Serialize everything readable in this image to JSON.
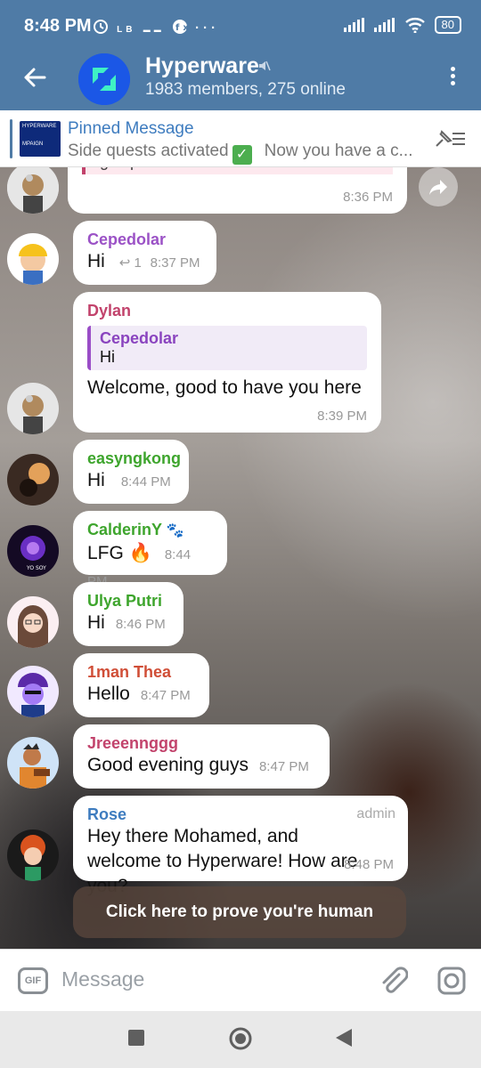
{
  "status": {
    "time": "8:48 PM",
    "icons": [
      "alarm-icon",
      "lb-icon",
      "app-icon",
      "fx-icon",
      "more-icon"
    ],
    "battery": "80"
  },
  "header": {
    "title": "Hyperware",
    "subtitle": "1983 members, 275 online"
  },
  "pinned": {
    "title": "Pinned Message",
    "text_start": "Side quests activated",
    "text_end": "Now you have a c...",
    "thumb_text": "HYPERWARE",
    "thumb_text2": "MPAIGN"
  },
  "messages": [
    {
      "name": "",
      "text": "lightspeed.",
      "time": "8:36 PM"
    },
    {
      "name": "Cepedolar",
      "text": "Hi",
      "reply_count": "1",
      "time": "8:37 PM",
      "color": "#9b52c6"
    },
    {
      "name": "Dylan",
      "reply_name": "Cepedolar",
      "reply_text": "Hi",
      "text": "Welcome, good to have you here",
      "time": "8:39 PM",
      "color": "#c2436c"
    },
    {
      "name": "easyngkong",
      "text": "Hi",
      "time": "8:44 PM",
      "color": "#3ea52d"
    },
    {
      "name": "CalderinY",
      "name_suffix": "🐾",
      "text": "LFG",
      "emoji": "🔥",
      "time": "8:44 PM",
      "color": "#3ea52d"
    },
    {
      "name": "Ulya Putri",
      "text": "Hi",
      "time": "8:46 PM",
      "color": "#3ea52d"
    },
    {
      "name": "1man Thea",
      "text": "Hello",
      "time": "8:47 PM",
      "color": "#d04e37"
    },
    {
      "name": "Jreeennggg",
      "text": "Good evening guys",
      "time": "8:47 PM",
      "color": "#c2436c"
    },
    {
      "name": "Rose",
      "badge": "admin",
      "text": "Hey there Mohamed, and welcome to Hyperware! How are you?",
      "time": "8:48 PM",
      "color": "#3e7cbf"
    }
  ],
  "human_button": "Click here to prove you're human",
  "composer": {
    "gif_label": "GIF",
    "placeholder": "Message"
  },
  "colors": {
    "header": "#4f7ba6",
    "accent": "#3e7cbf"
  }
}
